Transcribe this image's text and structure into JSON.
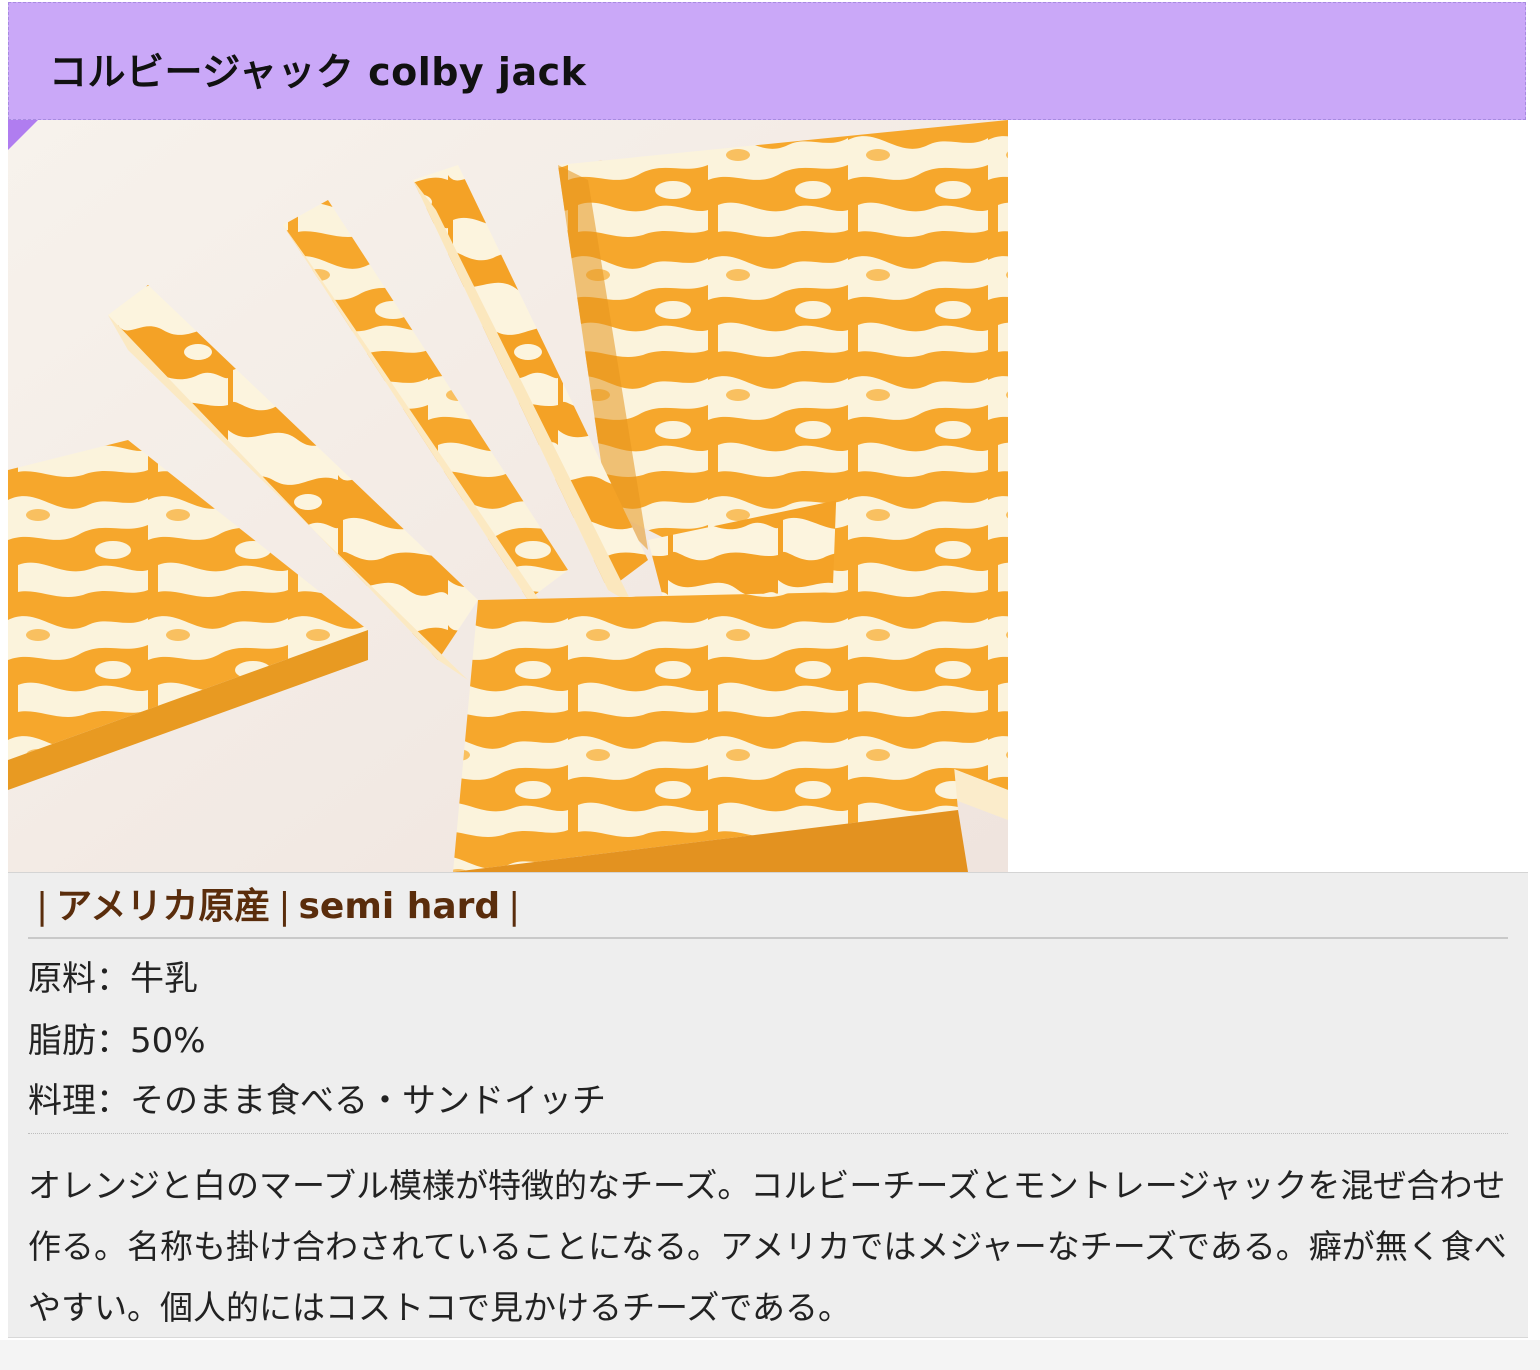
{
  "title": "コルビージャック colby jack",
  "tags": {
    "origin": "アメリカ原産",
    "type": "semi hard",
    "separator": "|"
  },
  "specs": {
    "ingredients": "原料：牛乳",
    "fat": "脂肪：50%",
    "dishes": "料理：そのまま食べる・サンドイッチ"
  },
  "description": "オレンジと白のマーブル模様が特徴的なチーズ。コルビーチーズとモントレージャックを混ぜ合わせ作る。名称も掛け合わされていることになる。アメリカではメジャーなチーズである。癖が無く食べやすい。個人的にはコストコで見かけるチーズである。",
  "colors": {
    "title_bar": "#caa8f8",
    "tag_text": "#5a2d0c",
    "panel_bg": "#eeeeee",
    "cheese_orange": "#f2a52a",
    "cheese_white": "#fbf3dc"
  }
}
